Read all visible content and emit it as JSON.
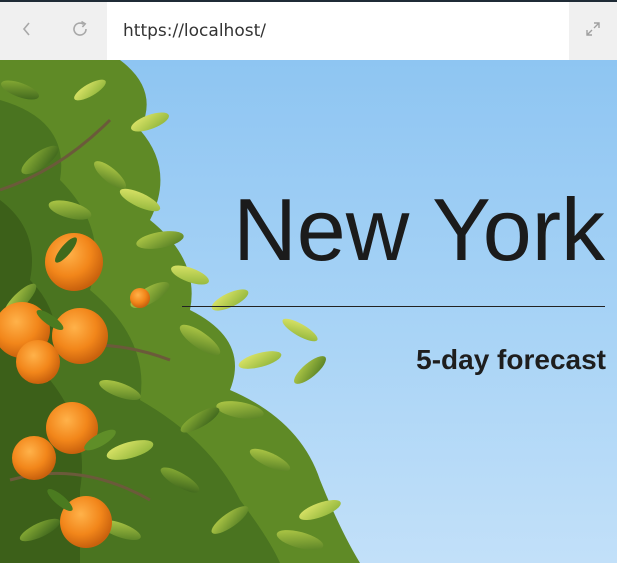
{
  "browser": {
    "url": "https://localhost/"
  },
  "icons": {
    "back": "chevron-left-icon",
    "reload": "reload-icon",
    "expand": "expand-icon"
  },
  "hero": {
    "city": "New York",
    "subtitle": "5-day forecast"
  },
  "colors": {
    "sky": "#a9d4f6",
    "leaf": "#6f9a2c",
    "orange": "#f28a1c",
    "title": "#1b1b1b"
  }
}
